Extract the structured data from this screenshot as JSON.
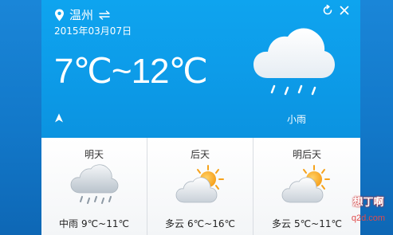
{
  "header": {
    "city": "温州",
    "date": "2015年03月07日"
  },
  "current": {
    "temp_range": "7℃~12℃",
    "condition": "小雨",
    "icon": "rain-cloud-icon"
  },
  "forecast": [
    {
      "day": "明天",
      "condition": "中雨",
      "temp": "9℃~11℃",
      "icon": "rain-cloud-icon"
    },
    {
      "day": "后天",
      "condition": "多云",
      "temp": "6℃~16℃",
      "icon": "sun-cloud-icon"
    },
    {
      "day": "明后天",
      "condition": "多云",
      "temp": "5℃~11℃",
      "icon": "sun-cloud-icon"
    }
  ],
  "watermark": {
    "text": "想丁啊",
    "url": "q2d.com"
  },
  "colors": {
    "panel_blue": "#0ea4ef",
    "desktop_blue": "#1278c9",
    "card_bg": "#f5f7f9",
    "sun": "#f6a21b"
  }
}
